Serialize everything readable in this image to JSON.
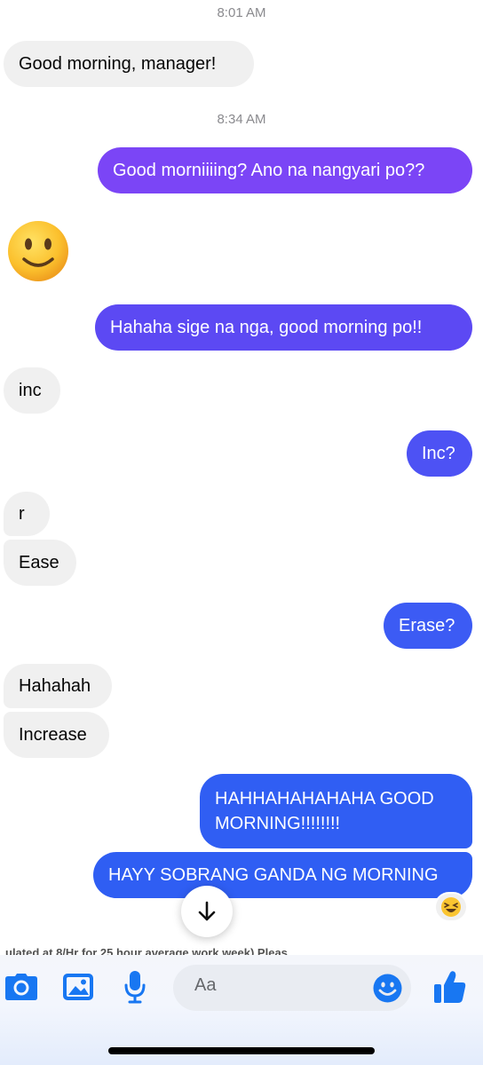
{
  "thread": {
    "timestamps": [
      "8:01 AM",
      "8:34 AM"
    ],
    "messages": [
      {
        "dir": "in",
        "text": "Good morning, manager!"
      },
      {
        "dir": "out",
        "text": "Good morniiiing? Ano na nangyari po??"
      },
      {
        "dir": "in",
        "emoji": "slightly-smiling-face"
      },
      {
        "dir": "out",
        "text": "Hahaha sige na nga, good morning po!!"
      },
      {
        "dir": "in",
        "text": "inc"
      },
      {
        "dir": "out",
        "text": "Inc?"
      },
      {
        "dir": "in",
        "text": "r"
      },
      {
        "dir": "in",
        "text": "Ease"
      },
      {
        "dir": "out",
        "text": "Erase?"
      },
      {
        "dir": "in",
        "text": "Hahahah"
      },
      {
        "dir": "in",
        "text": "Increase"
      },
      {
        "dir": "out",
        "text": "HAHHAHAHAHAHA GOOD MORNING!!!!!!!!"
      },
      {
        "dir": "out",
        "text": "HAYY SOBRANG GANDA NG MORNING"
      }
    ],
    "reaction": "laughing-squinting-face",
    "colors": {
      "incoming_bg": "#f0f0f0",
      "outgoing_purple": "#7b45f6",
      "outgoing_indigo": "#5c49f3",
      "outgoing_blue": "#2f5ef3",
      "accent_blue": "#1877f2"
    }
  },
  "preview_text": "ulated at 8/Hr for 25 hour average work week) Pleas",
  "composer": {
    "placeholder": "Aa",
    "icons": [
      "camera-icon",
      "photo-icon",
      "microphone-icon",
      "emoji-icon",
      "thumbs-up-icon"
    ]
  }
}
